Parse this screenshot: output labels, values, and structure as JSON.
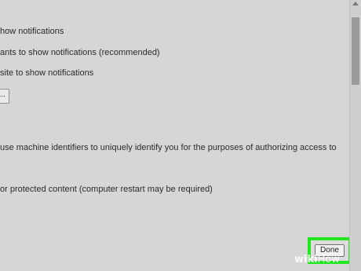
{
  "content_settings": {
    "notifications": {
      "option_block": "how notifications",
      "option_ask": "ants to show notifications (recommended)",
      "option_allow": "site to show notifications",
      "manage_button": "..."
    },
    "protected_content": {
      "identifiers_text": "use machine identifiers to uniquely identify you for the purposes of authorizing access to",
      "restart_text": "or protected content (computer restart may be required)"
    },
    "done_label": "Done"
  },
  "watermark": {
    "wiki": "wiki",
    "how": "How"
  },
  "colors": {
    "highlight": "#1fe81f",
    "panel": "#d6d6d6"
  }
}
